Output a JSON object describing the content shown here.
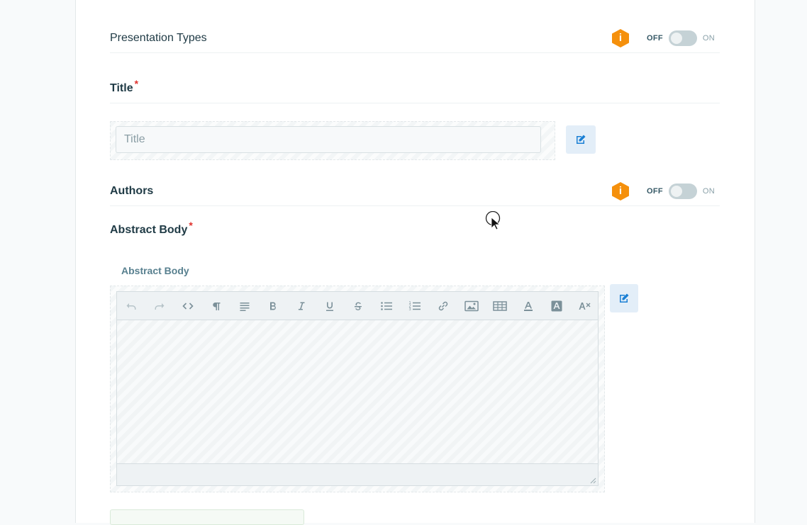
{
  "fields": {
    "presentation_types": {
      "label": "Presentation Types",
      "toggle_off": "OFF",
      "toggle_on": "ON",
      "info_icon": "i"
    },
    "title": {
      "label": "Title",
      "required_mark": "*",
      "input_value": "",
      "input_placeholder": "Title"
    },
    "authors": {
      "label": "Authors",
      "toggle_off": "OFF",
      "toggle_on": "ON",
      "info_icon": "i"
    },
    "abstract_body": {
      "label": "Abstract Body",
      "required_mark": "*",
      "editor_label": "Abstract Body",
      "toolbar": [
        "undo-icon",
        "redo-icon",
        "code-icon",
        "paragraph-icon",
        "align-icon",
        "bold-icon",
        "italic-icon",
        "underline-icon",
        "strikethrough-icon",
        "bullet-list-icon",
        "numbered-list-icon",
        "link-icon",
        "image-icon",
        "table-icon",
        "text-color-icon",
        "highlight-icon",
        "clear-format-icon"
      ]
    }
  },
  "colors": {
    "accent": "#1a7fd4",
    "warning": "#f5900c",
    "required": "#e0322e"
  }
}
